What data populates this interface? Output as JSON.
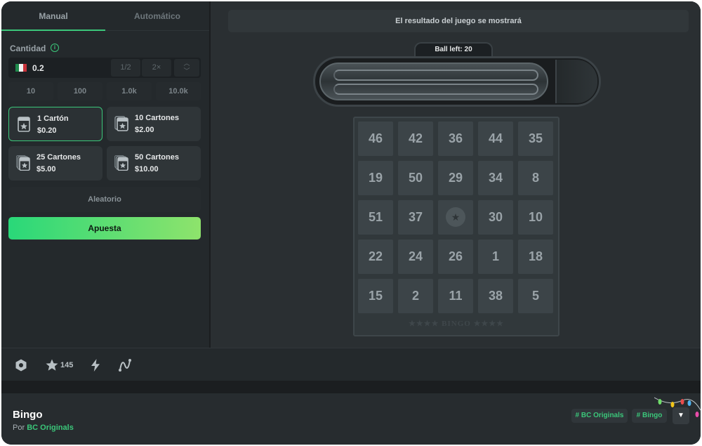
{
  "tabs": [
    {
      "label": "Manual",
      "active": true
    },
    {
      "label": "Automático",
      "active": false
    }
  ],
  "amount": {
    "label": "Cantidad",
    "value": "0.2",
    "half_label": "1/2",
    "double_label": "2×",
    "presets": [
      "10",
      "100",
      "1.0k",
      "10.0k"
    ]
  },
  "cards": [
    {
      "title": "1 Cartón",
      "price": "$0.20",
      "selected": true
    },
    {
      "title": "10 Cartones",
      "price": "$2.00",
      "selected": false
    },
    {
      "title": "25 Cartones",
      "price": "$5.00",
      "selected": false
    },
    {
      "title": "50 Cartones",
      "price": "$10.00",
      "selected": false
    }
  ],
  "random_label": "Aleatorio",
  "bet_label": "Apuesta",
  "result_text": "El resultado del juego se mostrará",
  "balls_left": "Ball left: 20",
  "board": {
    "rows": [
      [
        "46",
        "42",
        "36",
        "44",
        "35"
      ],
      [
        "19",
        "50",
        "29",
        "34",
        "8"
      ],
      [
        "51",
        "37",
        "★",
        "30",
        "10"
      ],
      [
        "22",
        "24",
        "26",
        "1",
        "18"
      ],
      [
        "15",
        "2",
        "11",
        "38",
        "5"
      ]
    ],
    "footer": "★★★★ BINGO ★★★★"
  },
  "toolbar": {
    "favorites_count": "145"
  },
  "footer": {
    "game_name": "Bingo",
    "by_prefix": "Por",
    "provider": "BC Originals",
    "tags": [
      "# BC Originals",
      "# Bingo"
    ]
  },
  "colors": {
    "accent": "#3bc77a",
    "bet_gradient_start": "#29d879",
    "bet_gradient_end": "#8ee36c",
    "background": "#1b1e20"
  }
}
